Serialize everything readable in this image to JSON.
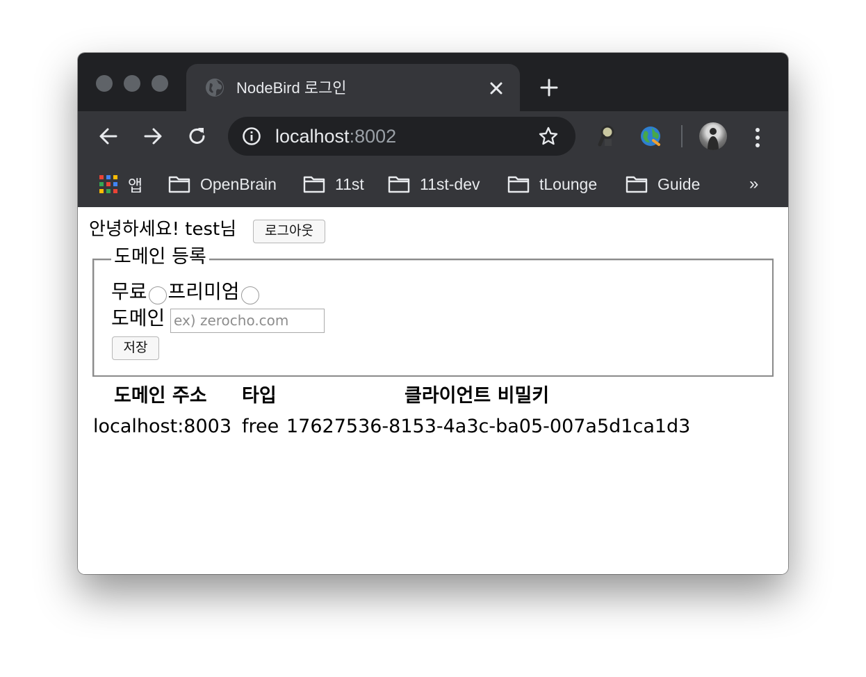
{
  "browser": {
    "tab_title": "NodeBird 로그인",
    "url_host": "localhost",
    "url_port": ":8002",
    "bookmarks": [
      {
        "label": "앱",
        "icon": "apps-grid-icon"
      },
      {
        "label": "OpenBrain",
        "icon": "folder-icon"
      },
      {
        "label": "11st",
        "icon": "folder-icon"
      },
      {
        "label": "11st-dev",
        "icon": "folder-icon"
      },
      {
        "label": "tLounge",
        "icon": "folder-icon"
      },
      {
        "label": "Guide",
        "icon": "folder-icon"
      }
    ],
    "bookmarks_more": "»",
    "colors": {
      "titlebar": "#202124",
      "toolbar": "#35363a",
      "text": "#e8eaed"
    }
  },
  "page": {
    "greeting": "안녕하세요! test님",
    "logout_label": "로그아웃",
    "form": {
      "legend": "도메인 등록",
      "radio_free_label": "무료",
      "radio_premium_label": "프리미엄",
      "domain_label": "도메인",
      "domain_placeholder": "ex) zerocho.com",
      "save_label": "저장"
    },
    "table": {
      "headers": [
        "도메인 주소",
        "타입",
        "클라이언트 비밀키"
      ],
      "rows": [
        [
          "localhost:8003",
          "free",
          "17627536-8153-4a3c-ba05-007a5d1ca1d3"
        ]
      ]
    }
  }
}
